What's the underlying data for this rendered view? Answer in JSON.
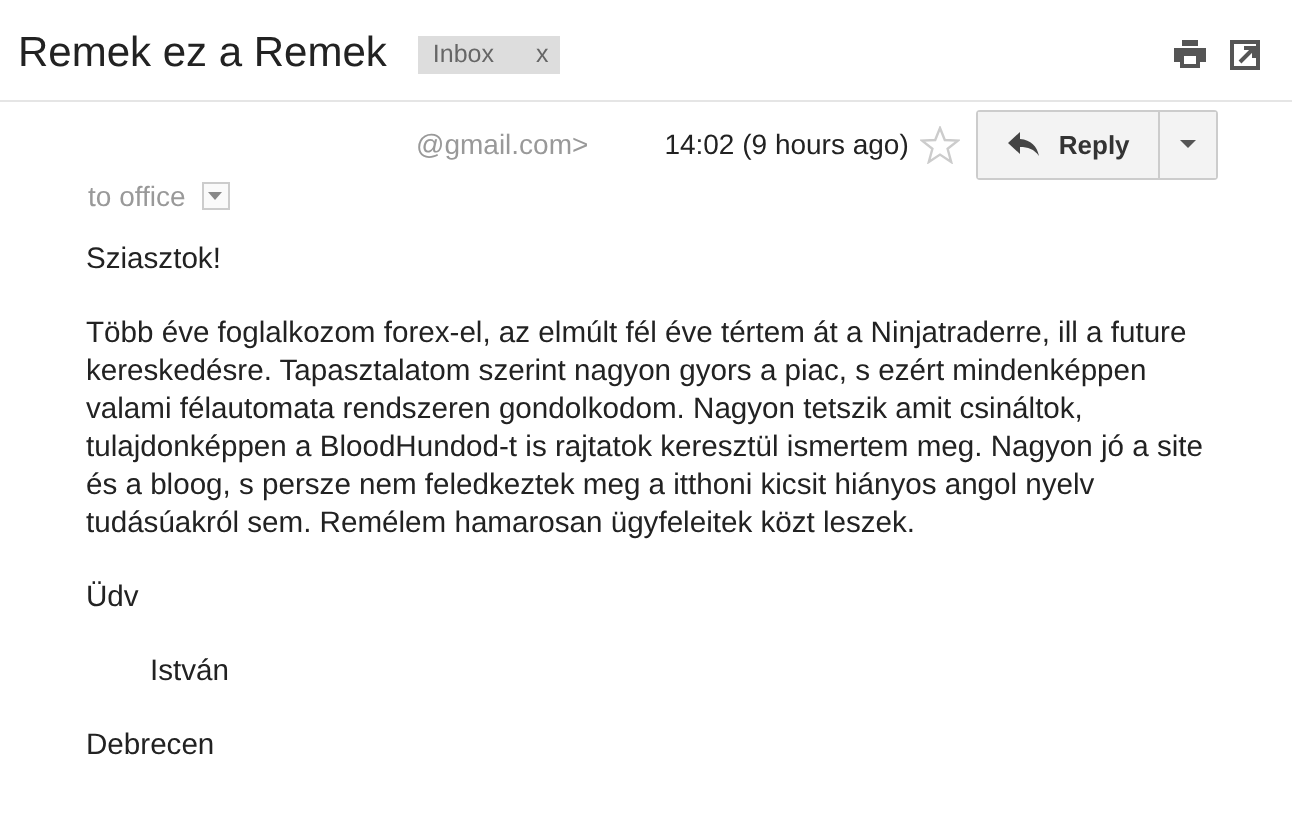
{
  "subject": "Remek ez a Remek",
  "labels": [
    {
      "text": "Inbox",
      "remove": "x"
    }
  ],
  "sender": {
    "email": "@gmail.com>",
    "time": "14:02 (9 hours ago)",
    "starred": false
  },
  "reply_button": "Reply",
  "recipient": "to office",
  "body": [
    {
      "kind": "para",
      "text": "Sziasztok!"
    },
    {
      "kind": "para",
      "text": "Több éve foglalkozom forex-el, az elmúlt fél éve tértem át a Ninjatraderre, ill a future kereskedésre. Tapasztalatom szerint nagyon gyors a piac, s ezért mindenképpen valami félautomata rendszeren gondolkodom. Nagyon tetszik amit csináltok, tulajdonképpen a BloodHundod-t is rajtatok keresztül ismertem meg. Nagyon jó a site és a bloog, s persze nem feledkeztek meg a itthoni kicsit hiányos angol nyelv tudásúakról sem. Remélem hamarosan ügyfeleitek közt leszek."
    },
    {
      "kind": "para",
      "text": "Üdv"
    },
    {
      "kind": "indent",
      "text": "István"
    },
    {
      "kind": "para",
      "text": "Debrecen"
    }
  ]
}
